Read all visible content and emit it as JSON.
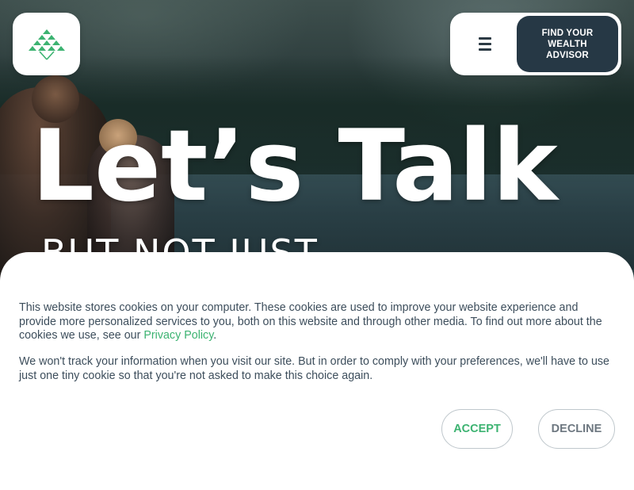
{
  "header": {
    "logo_icon": "pine-trees-logo-icon",
    "menu_icon": "hamburger-menu-icon",
    "advisor_button_label": "FIND YOUR\nWEALTH\nADVISOR"
  },
  "hero": {
    "headline": "Let’s Talk",
    "subheadline": "BUT NOT JUST"
  },
  "cookie_banner": {
    "paragraph1_text": "This website stores cookies on your computer. These cookies are used to improve your website experience and provide more personalized services to you, both on this website and through other media. To find out more about the cookies we use, see our ",
    "privacy_link_label": "Privacy Policy",
    "paragraph1_end": ".",
    "paragraph2_text": "We won't track your information when you visit our site. But in order to comply with your preferences, we'll have to use just one tiny cookie so that you're not asked to make this choice again.",
    "accept_label": "ACCEPT",
    "decline_label": "DECLINE"
  },
  "colors": {
    "accent_green": "#3cb371",
    "navy_button": "#263845",
    "body_text": "#3d4e5c"
  }
}
